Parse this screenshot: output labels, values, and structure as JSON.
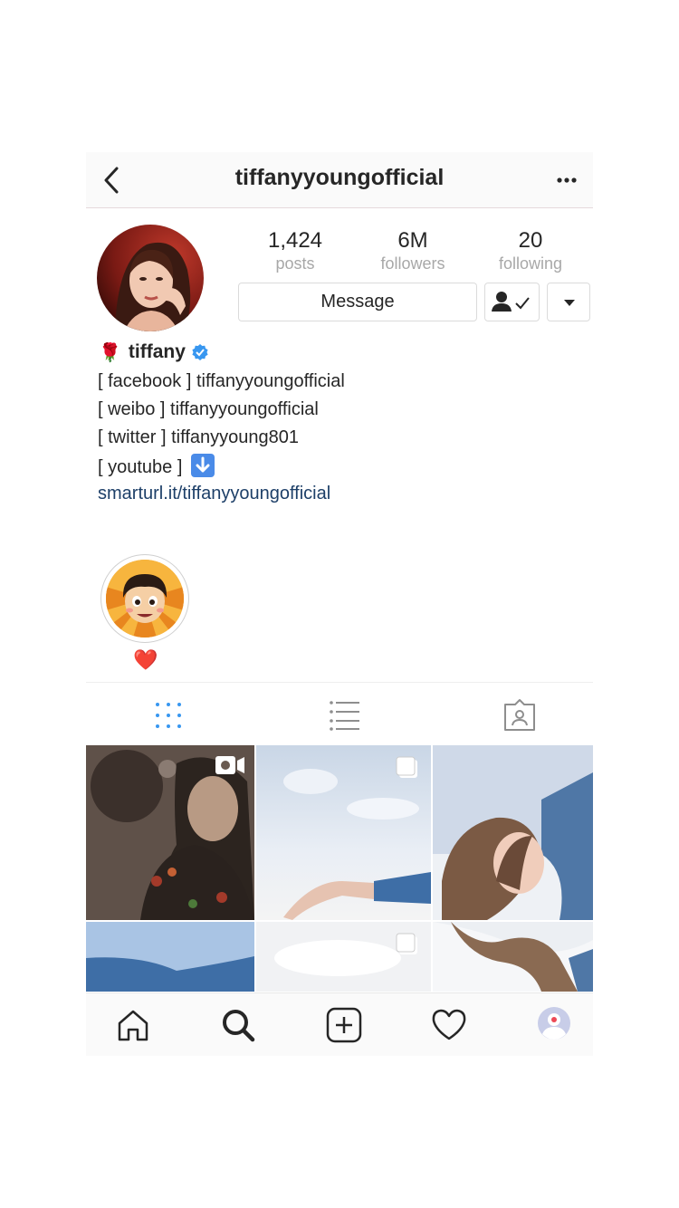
{
  "header": {
    "title": "tiffanyyoungofficial",
    "back_icon": "chevron-left-icon",
    "more_icon": "more-horizontal-icon"
  },
  "profile": {
    "stats": [
      {
        "value": "1,424",
        "label": "posts"
      },
      {
        "value": "6M",
        "label": "followers"
      },
      {
        "value": "20",
        "label": "following"
      }
    ],
    "message_label": "Message",
    "following_icon": "user-check-icon",
    "dropdown_icon": "caret-down-icon",
    "name_emoji": "🌹",
    "name": "tiffany",
    "verified_icon": "verified-badge-icon",
    "bio": {
      "line1": "[ facebook ] tiffanyyoungofficial",
      "line2": "[ weibo ] tiffanyyoungofficial",
      "line3": "[ twitter ] tiffanyyoung801",
      "line4": "[ youtube ]",
      "line4_icon": "down-arrow-emoji-icon",
      "link": "smarturl.it/tiffanyyoungofficial"
    }
  },
  "highlight": {
    "label": "❤️"
  },
  "tabs": [
    {
      "name": "grid-view",
      "icon": "grid-icon",
      "active": true
    },
    {
      "name": "list-view",
      "icon": "list-icon",
      "active": false
    },
    {
      "name": "tagged",
      "icon": "tagged-icon",
      "active": false
    }
  ],
  "grid": [
    {
      "badge": "video-icon"
    },
    {
      "badge": "multiple-photos-icon"
    },
    {
      "badge": ""
    },
    {
      "badge": ""
    },
    {
      "badge": "multiple-photos-icon"
    },
    {
      "badge": ""
    }
  ],
  "bottom_nav": [
    {
      "name": "home",
      "icon": "home-icon"
    },
    {
      "name": "search",
      "icon": "search-icon",
      "active": true
    },
    {
      "name": "new-post",
      "icon": "add-post-icon"
    },
    {
      "name": "activity",
      "icon": "heart-icon"
    },
    {
      "name": "profile",
      "icon": "profile-avatar-icon",
      "has_notification": true
    }
  ],
  "colors": {
    "link": "#1d3f68",
    "verified": "#3897f0",
    "active_tab": "#3897f0",
    "notification": "#ed4956"
  }
}
